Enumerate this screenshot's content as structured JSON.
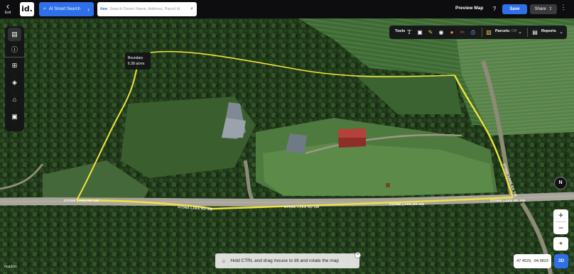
{
  "header": {
    "exit_label": "Exit",
    "logo_text": "id.",
    "ai_search_label": "AI Smart Search",
    "search_new_badge": "New",
    "search_placeholder": "Search Owner Name, Address, Parcel Id",
    "preview_map_label": "Preview Map",
    "help_label": "?",
    "save_label": "Save",
    "share_label": "Share"
  },
  "left_toolbar": {
    "icons": [
      "layers-panel-icon",
      "info-icon",
      "map-icon",
      "stack-icon",
      "buildings-icon",
      "image-icon"
    ]
  },
  "tools_bar": {
    "label": "Tools",
    "parcels_label": "Parcels:",
    "parcels_state": "Off",
    "reports_label": "Reports"
  },
  "boundary": {
    "title": "Boundary",
    "area": "6.38 acres",
    "color": "#f2e33b"
  },
  "roads": [
    {
      "label": "STONE LAKE RD SW"
    },
    {
      "label": "STONE LAKE RD SW"
    },
    {
      "label": "STONE LAKE RD SW"
    },
    {
      "label": "STONE LAKE RD SW"
    },
    {
      "label": "STONE LAKE RD SW"
    },
    {
      "label": "STONE LAKE RD SW"
    }
  ],
  "map_controls": {
    "compass_label": "N",
    "zoom_in": "+",
    "zoom_out": "−",
    "coordinates": "47.4529, -94.9823",
    "view_3d_label": "3D"
  },
  "hint": {
    "text": "Hold CTRL and drag mouse to tilt and rotate the map"
  },
  "attribution": "mapbox",
  "colors": {
    "accent": "#2f6fe8",
    "topbar": "#0d0d0f",
    "road_highlight": "#f2e33b"
  }
}
